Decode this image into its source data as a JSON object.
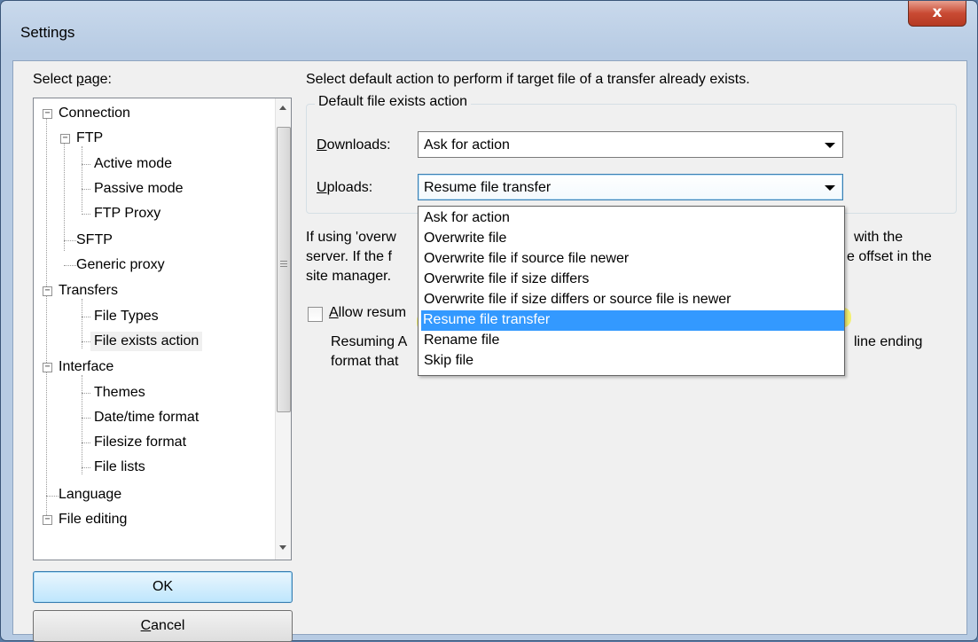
{
  "window": {
    "title": "Settings",
    "close_glyph": "x"
  },
  "left": {
    "select_page_prefix": "Select ",
    "select_page_key": "p",
    "select_page_suffix": "age:",
    "tree": [
      {
        "label": "Connection",
        "expander": "−"
      },
      {
        "label": "FTP",
        "expander": "−"
      },
      {
        "label": "Active mode"
      },
      {
        "label": "Passive mode"
      },
      {
        "label": "FTP Proxy"
      },
      {
        "label": "SFTP"
      },
      {
        "label": "Generic proxy"
      },
      {
        "label": "Transfers",
        "expander": "−"
      },
      {
        "label": "File Types"
      },
      {
        "label": "File exists action",
        "selected": true
      },
      {
        "label": "Interface",
        "expander": "−"
      },
      {
        "label": "Themes"
      },
      {
        "label": "Date/time format"
      },
      {
        "label": "Filesize format"
      },
      {
        "label": "File lists"
      },
      {
        "label": "Language"
      },
      {
        "label": "File editing",
        "expander": "−"
      }
    ],
    "ok_label": "OK",
    "cancel_key": "C",
    "cancel_rest": "ancel"
  },
  "main": {
    "description": "Select default action to perform if target file of a transfer already exists.",
    "group_title": "Default file exists action",
    "downloads_key": "D",
    "downloads_rest": "ownloads:",
    "downloads_value": "Ask for action",
    "uploads_key": "U",
    "uploads_rest": "ploads:",
    "uploads_value": "Resume file transfer",
    "options": [
      "Ask for action",
      "Overwrite file",
      "Overwrite file if source file newer",
      "Overwrite file if size differs",
      "Overwrite file if size differs or source file is newer",
      "Resume file transfer",
      "Rename file",
      "Skip file"
    ],
    "highlighted_index": 5,
    "para1_a": "If using 'overw",
    "para1_b": "with the",
    "para2_a": "server. If the f",
    "para2_b": "e offset in the",
    "para3_a": "site manager.",
    "checkbox_key": "A",
    "checkbox_rest": "llow resum",
    "resume_a": "Resuming A",
    "resume_b": "line ending",
    "resume_c": "format that"
  },
  "colors": {
    "highlight": "#3399ff",
    "marker": "#f5f01e"
  }
}
